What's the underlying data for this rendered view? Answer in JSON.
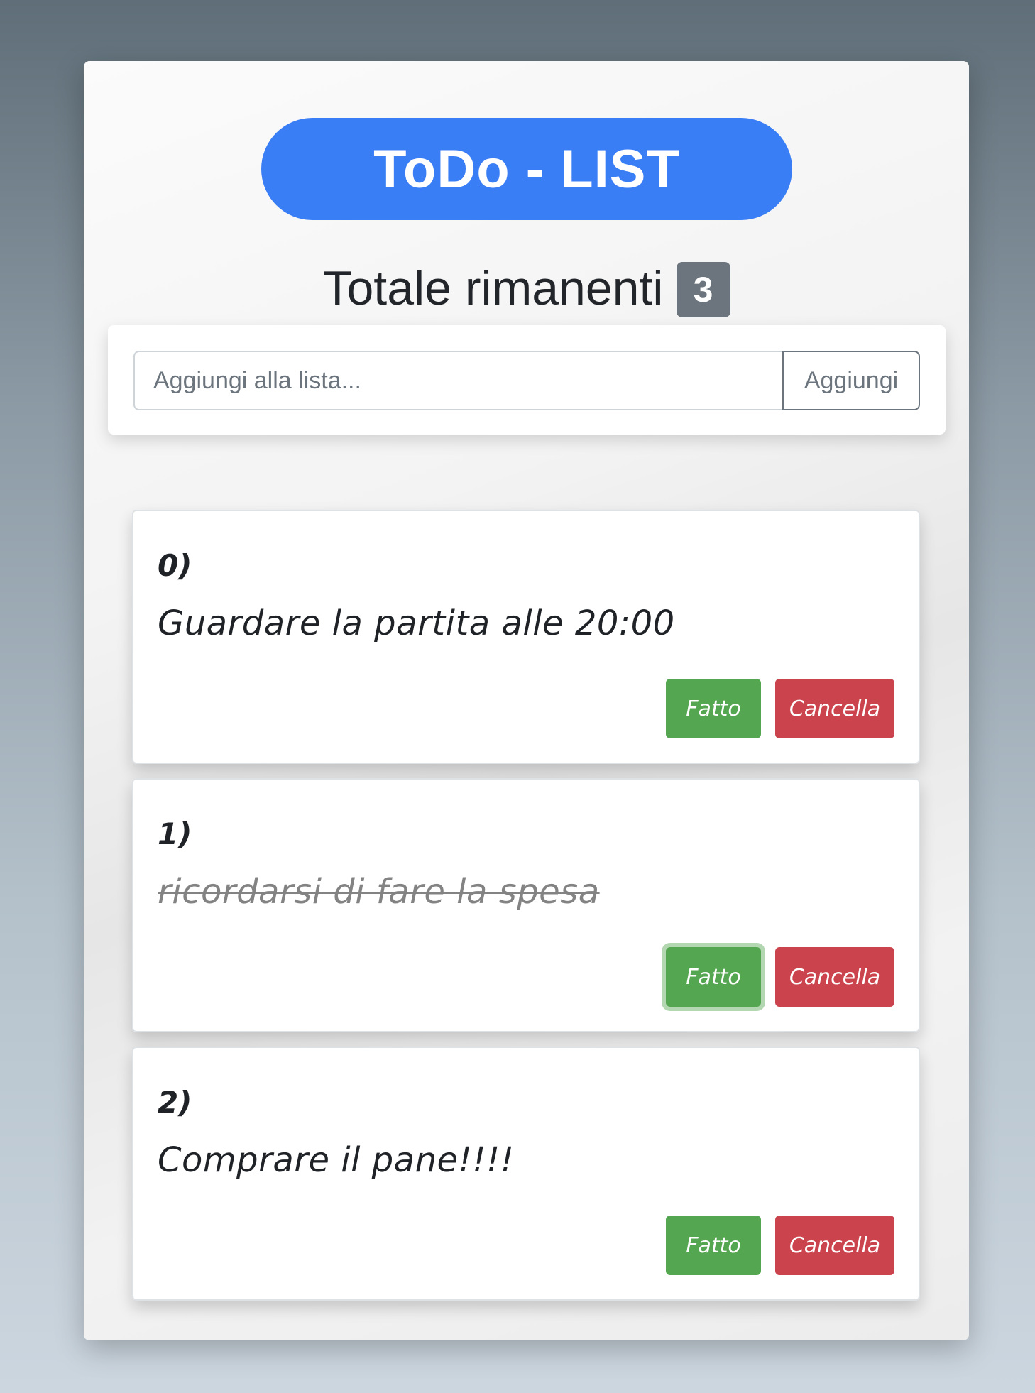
{
  "header": {
    "title": "ToDo - LIST",
    "remaining_label": "Totale rimanenti",
    "remaining_count": "3"
  },
  "add_form": {
    "placeholder": "Aggiungi alla lista...",
    "value": "",
    "button_label": "Aggiungi"
  },
  "tasks": [
    {
      "index": "0)",
      "text": "Guardare la partita alle 20:00",
      "done": false,
      "done_label": "Fatto",
      "delete_label": "Cancella"
    },
    {
      "index": "1)",
      "text": "ricordarsi di fare la spesa",
      "done": true,
      "done_label": "Fatto",
      "delete_label": "Cancella"
    },
    {
      "index": "2)",
      "text": "Comprare il pane!!!!",
      "done": false,
      "done_label": "Fatto",
      "delete_label": "Cancella"
    }
  ],
  "colors": {
    "title_bg": "#3a7ef6",
    "badge_bg": "#6c757d",
    "done_button": "#55a651",
    "delete_button": "#cb444d",
    "completed_text": "#838383"
  }
}
